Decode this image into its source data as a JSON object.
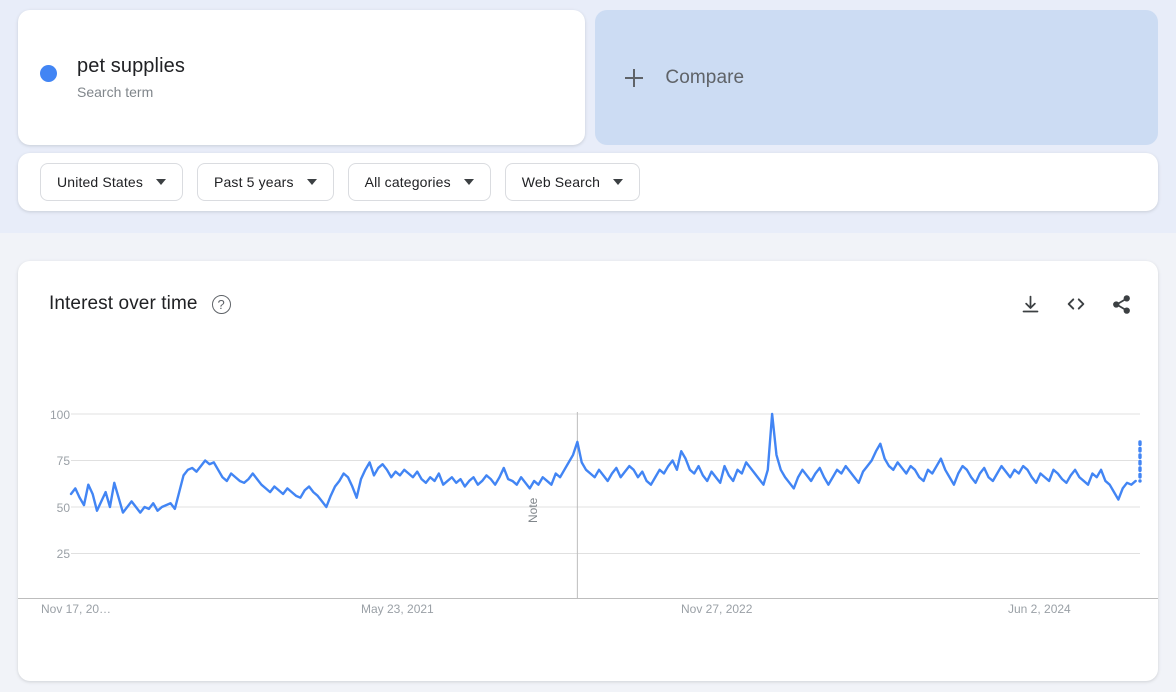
{
  "terms": [
    {
      "name": "pet supplies",
      "type_label": "Search term",
      "color": "#4285f4"
    }
  ],
  "compare": {
    "label": "Compare",
    "icon": "plus-icon"
  },
  "filters": [
    {
      "label": "United States",
      "name": "region"
    },
    {
      "label": "Past 5 years",
      "name": "time-range"
    },
    {
      "label": "All categories",
      "name": "category"
    },
    {
      "label": "Web Search",
      "name": "search-type"
    }
  ],
  "chart_panel": {
    "title": "Interest over time",
    "help_icon": "question-mark-icon",
    "actions": [
      {
        "name": "download-icon",
        "label": "Download CSV"
      },
      {
        "name": "embed-code-icon",
        "label": "Embed"
      },
      {
        "name": "share-icon",
        "label": "Share"
      }
    ]
  },
  "chart_data": {
    "type": "line",
    "title": "Interest over time",
    "xlabel": "",
    "ylabel": "",
    "ylim": [
      0,
      100
    ],
    "ytick_labels": [
      "100",
      "75",
      "50",
      "25"
    ],
    "ytick_values": [
      100,
      75,
      50,
      25
    ],
    "xtick_labels": [
      "Nov 17, 20…",
      "May 23, 2021",
      "Nov 27, 2022",
      "Jun 2, 2024"
    ],
    "grid": true,
    "legend_position": "none",
    "line_color": "#4285f4",
    "annotations": [
      {
        "label": "Note",
        "x_index": 117,
        "orientation": "vertical"
      }
    ],
    "partial_last_point": true,
    "series": [
      {
        "name": "pet supplies",
        "color": "#4285f4",
        "values": [
          57,
          60,
          55,
          51,
          62,
          57,
          48,
          53,
          58,
          50,
          63,
          55,
          47,
          50,
          53,
          50,
          47,
          50,
          49,
          52,
          48,
          50,
          51,
          52,
          49,
          58,
          67,
          70,
          71,
          69,
          72,
          75,
          73,
          74,
          70,
          66,
          64,
          68,
          66,
          64,
          63,
          65,
          68,
          65,
          62,
          60,
          58,
          61,
          59,
          57,
          60,
          58,
          56,
          55,
          59,
          61,
          58,
          56,
          53,
          50,
          56,
          61,
          64,
          68,
          66,
          61,
          55,
          65,
          70,
          74,
          67,
          71,
          73,
          70,
          66,
          69,
          67,
          70,
          68,
          66,
          69,
          65,
          63,
          66,
          64,
          68,
          62,
          64,
          66,
          63,
          65,
          61,
          64,
          66,
          62,
          64,
          67,
          65,
          62,
          66,
          71,
          65,
          64,
          62,
          66,
          63,
          60,
          64,
          62,
          66,
          64,
          62,
          68,
          66,
          70,
          74,
          78,
          85,
          74,
          70,
          68,
          66,
          70,
          67,
          64,
          68,
          71,
          66,
          69,
          72,
          70,
          66,
          69,
          64,
          62,
          66,
          70,
          68,
          72,
          75,
          70,
          80,
          76,
          70,
          68,
          72,
          67,
          64,
          69,
          66,
          63,
          72,
          67,
          64,
          70,
          68,
          74,
          71,
          68,
          65,
          62,
          70,
          100,
          78,
          70,
          66,
          63,
          60,
          66,
          70,
          67,
          64,
          68,
          71,
          66,
          62,
          66,
          70,
          68,
          72,
          69,
          66,
          63,
          69,
          72,
          75,
          80,
          84,
          76,
          72,
          70,
          74,
          71,
          68,
          72,
          70,
          66,
          64,
          70,
          68,
          72,
          76,
          70,
          66,
          62,
          68,
          72,
          70,
          66,
          63,
          68,
          71,
          66,
          64,
          68,
          72,
          69,
          66,
          70,
          68,
          72,
          70,
          66,
          63,
          68,
          66,
          64,
          70,
          68,
          65,
          63,
          67,
          70,
          66,
          64,
          62,
          68,
          66,
          70,
          64,
          62,
          58,
          54,
          60,
          63,
          62,
          64,
          85
        ]
      }
    ]
  }
}
